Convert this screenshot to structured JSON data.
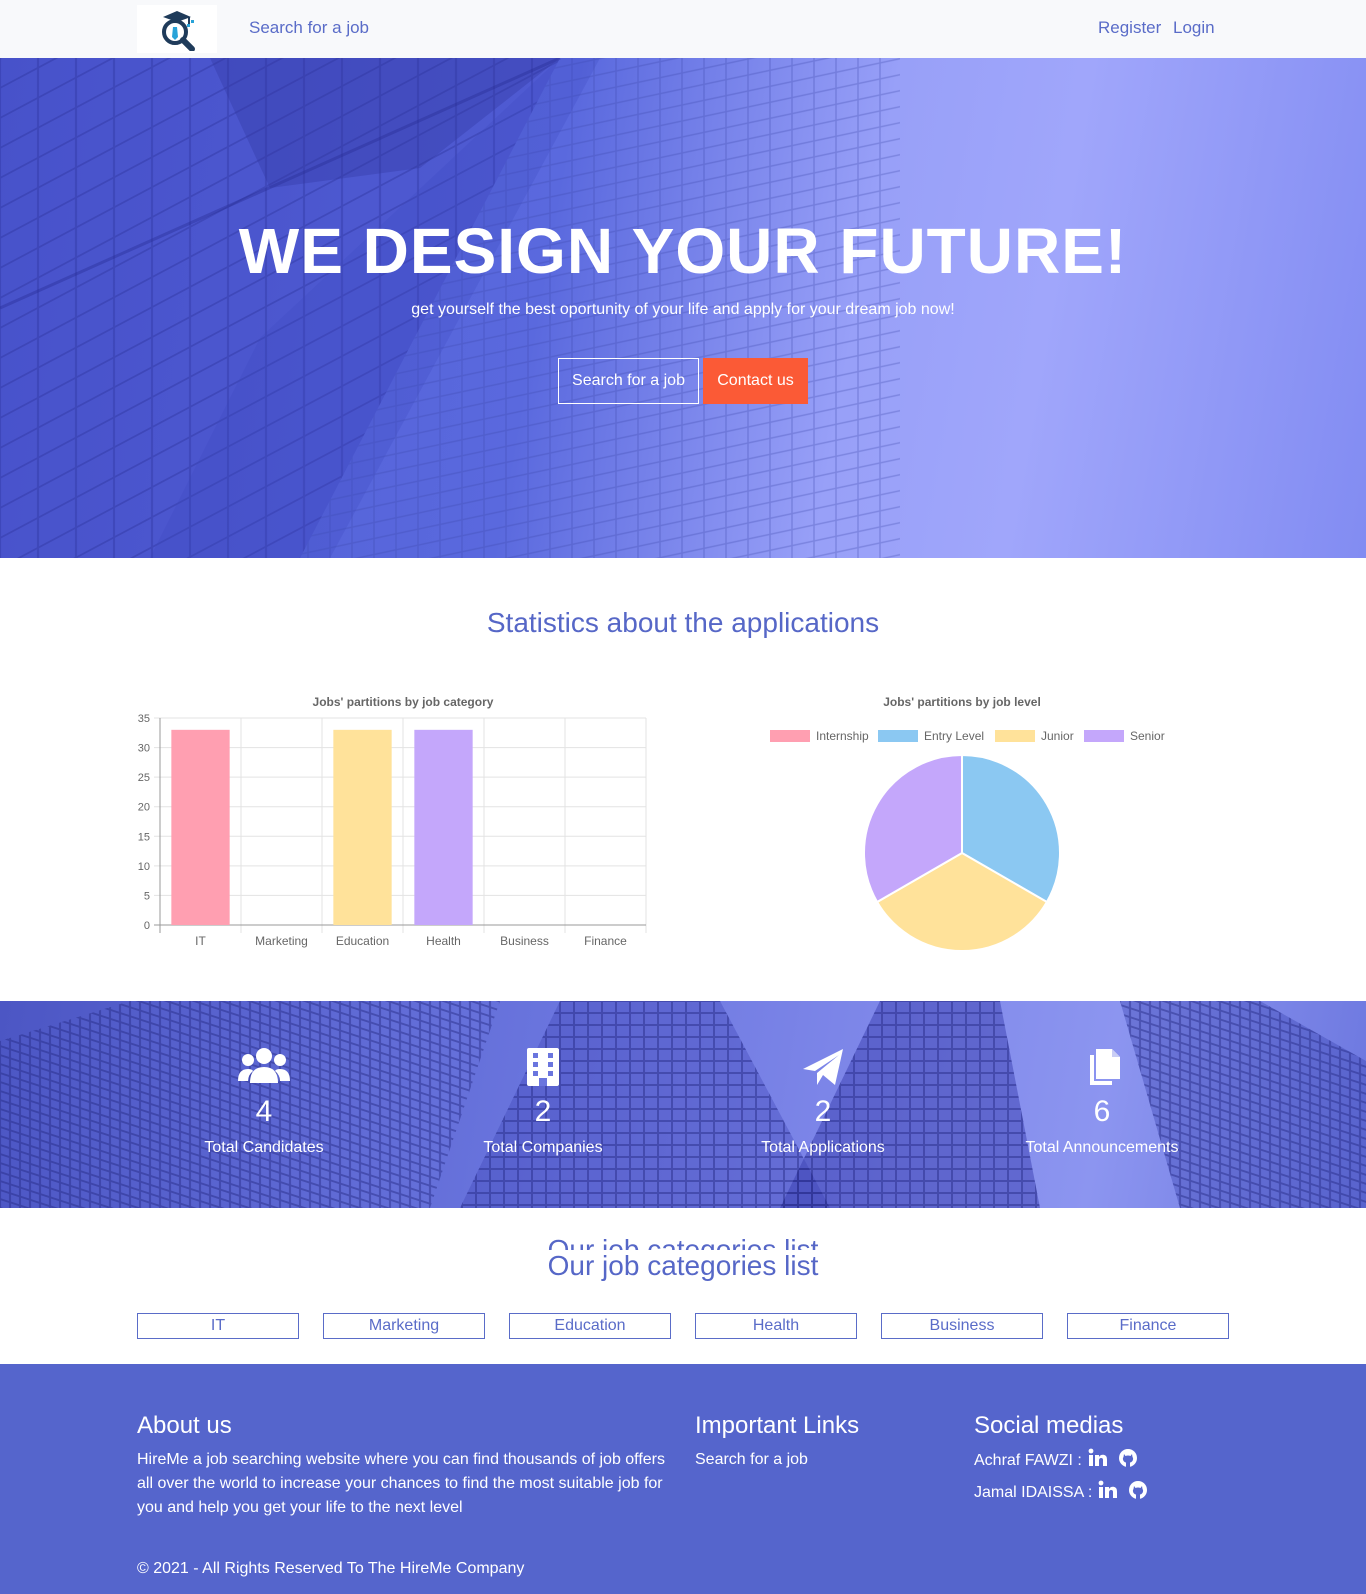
{
  "navbar": {
    "logo_icon": "graduate-magnifier-logo",
    "search_label": "Search for a job",
    "register_label": "Register",
    "login_label": "Login"
  },
  "hero": {
    "title": "WE DESIGN YOUR FUTURE!",
    "subtitle": "get yourself the best oportunity of your life and apply for your dream job now!",
    "search_button": "Search for a job",
    "contact_button": "Contact us"
  },
  "statistics": {
    "title": "Statistics about the applications"
  },
  "chart_data": [
    {
      "type": "bar",
      "title": "Jobs' partitions by job category",
      "categories": [
        "IT",
        "Marketing",
        "Education",
        "Health",
        "Business",
        "Finance"
      ],
      "values": [
        33,
        0,
        33,
        33,
        0,
        0
      ],
      "colors": [
        "#ff9fb1",
        "#ffb27a",
        "#ffe29a",
        "#c4a7fb",
        "#8ad0cd",
        "#8ec8f2"
      ],
      "ylim": [
        0,
        35
      ],
      "yticks": [
        "0",
        "5",
        "10",
        "15",
        "20",
        "25",
        "30",
        "35"
      ],
      "grid": true
    },
    {
      "type": "pie",
      "title": "Jobs' partitions by job level",
      "legend_position": "top",
      "labels": [
        "Internship",
        "Entry Level",
        "Junior",
        "Senior"
      ],
      "values": [
        0,
        33.3,
        33.3,
        33.3
      ],
      "colors": [
        "#ff9fb1",
        "#8bc8f2",
        "#ffe29a",
        "#c4a7fb"
      ]
    }
  ],
  "counters": [
    {
      "icon": "users-icon",
      "value": "4",
      "label": "Total Candidates"
    },
    {
      "icon": "building-icon",
      "value": "2",
      "label": "Total Companies"
    },
    {
      "icon": "paper-plane-icon",
      "value": "2",
      "label": "Total Applications"
    },
    {
      "icon": "copy-icon",
      "value": "6",
      "label": "Total Announcements"
    }
  ],
  "categories": {
    "title": "Our job categories list",
    "items": [
      "IT",
      "Marketing",
      "Education",
      "Health",
      "Business",
      "Finance"
    ]
  },
  "footer": {
    "about_title": "About us",
    "about_text": "HireMe a job searching website where you can find thousands of job offers all over the world to increase your chances to find the most suitable job for you and help you get your life to the next level",
    "links_title": "Important Links",
    "links": [
      "Search for a job"
    ],
    "social_title": "Social medias",
    "socials": [
      {
        "name": "Achraf FAWZI :"
      },
      {
        "name": "Jamal IDAISSA :"
      }
    ],
    "copyright": "© 2021 - All Rights Reserved To The HireMe Company"
  },
  "colors": {
    "primary": "#5667c7",
    "accent": "#fb5a36",
    "footer_bg": "#5565cc"
  }
}
